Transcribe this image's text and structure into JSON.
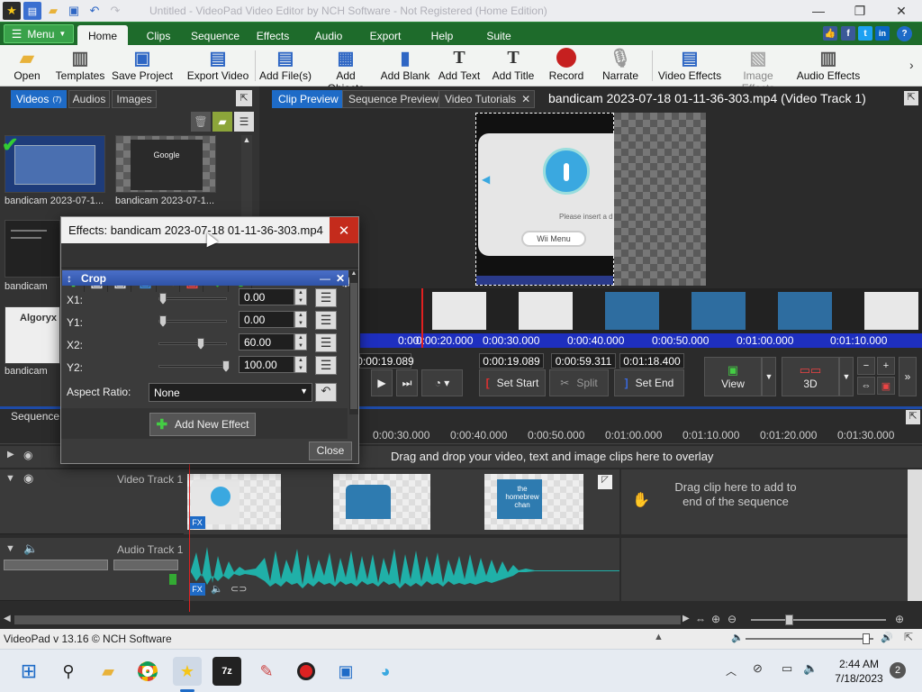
{
  "titlebar": {
    "title": "Untitled - VideoPad Video Editor by NCH Software - Not Registered (Home Edition)",
    "buttons": {
      "minimize": "—",
      "maximize": "❐",
      "close": "✕"
    }
  },
  "menu": {
    "menu_button": "Menu",
    "tabs": [
      "Home",
      "Clips",
      "Sequence",
      "Effects",
      "Audio",
      "Export",
      "Help",
      "Suite"
    ],
    "social": [
      "👍",
      "f",
      "t",
      "in",
      "?"
    ]
  },
  "ribbon": {
    "buttons": [
      "Open",
      "Templates",
      "Save Project",
      "Export Video",
      "Add File(s)",
      "Add Objects",
      "Add Blank",
      "Add Text",
      "Add Title",
      "Record",
      "Narrate",
      "Video Effects",
      "Image Effects",
      "Audio Effects"
    ]
  },
  "left_panel": {
    "tabs": {
      "videos": "Videos",
      "videos_count": "(7)",
      "audios": "Audios",
      "images": "Images"
    },
    "thumbs": [
      "bandicam 2023-07-1...",
      "bandicam 2023-07-1...",
      "bandicam",
      "bandicam"
    ],
    "thumb_texts": {
      "google": "Google",
      "algoryx": "Algoryx"
    }
  },
  "preview": {
    "tabs": [
      "Clip Preview",
      "Sequence Preview",
      "Video Tutorials"
    ],
    "title": "bandicam 2023-07-18 01-11-36-303.mp4 (Video Track 1)",
    "wii_text": "Please insert a d",
    "wii_menu": "Wii Menu",
    "ruler": [
      "0:00:20.000",
      "0:00:30.000",
      "0:00:40.000",
      "0:00:50.000",
      "0:01:00.000",
      "0:01:10.000"
    ],
    "ruler_start": "0:00",
    "times": {
      "current": "0:00:19.089",
      "start": "0:00:19.089",
      "duration": "0:00:59.311",
      "end": "0:01:18.400"
    },
    "buttons": {
      "set_start": "Set Start",
      "split": "Split",
      "set_end": "Set End",
      "view": "View",
      "three_d": "3D"
    }
  },
  "timeline": {
    "sequence_tab": "Sequence",
    "ruler": [
      "0:00:30.000",
      "0:00:40.000",
      "0:00:50.000",
      "0:01:00.000",
      "0:01:10.000",
      "0:01:20.000",
      "0:01:30.000"
    ],
    "overlay_hint": "Drag and drop your video, text and image clips here to overlay",
    "video_track": "Video Track 1",
    "audio_track": "Audio Track 1",
    "drop_hint": "Drag clip here to add to end of the sequence",
    "fx": "FX",
    "homebrew": "the homebrew chan"
  },
  "status": {
    "text": "VideoPad v 13.16 © NCH Software"
  },
  "taskbar": {
    "time": "2:44 AM",
    "date": "7/18/2023",
    "notifications": "2",
    "apps": [
      "7z"
    ]
  },
  "effects_dialog": {
    "title": "Effects: bandicam 2023-07-18 01-11-36-303.mp4",
    "effect_name": "Crop",
    "params": [
      {
        "label": "X1:",
        "value": "0.00",
        "level": 0
      },
      {
        "label": "Y1:",
        "value": "0.00",
        "level": 0
      },
      {
        "label": "X2:",
        "value": "60.00",
        "level": 0.6
      },
      {
        "label": "Y2:",
        "value": "100.00",
        "level": 1.0
      }
    ],
    "aspect_label": "Aspect Ratio:",
    "aspect_value": "None",
    "add_effect": "Add New Effect",
    "close": "Close"
  }
}
